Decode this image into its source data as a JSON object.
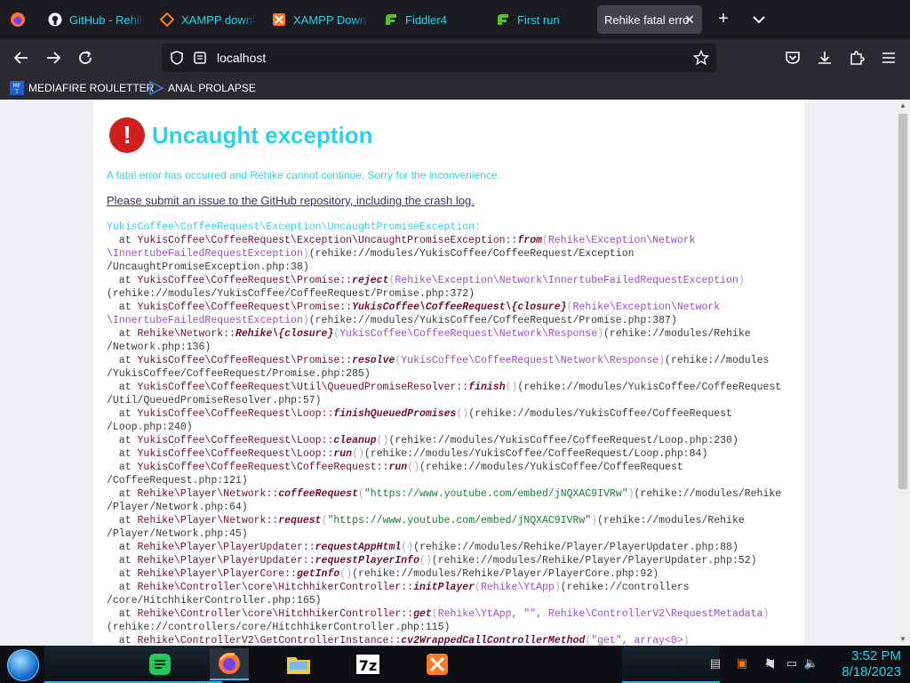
{
  "browser": {
    "tabs": [
      {
        "label": "GitHub - Rehike",
        "icon": "github-icon",
        "active": false
      },
      {
        "label": "XAMPP download",
        "icon": "xampp-icon",
        "active": false
      },
      {
        "label": "XAMPP Downloads",
        "icon": "xampp-icon",
        "active": false
      },
      {
        "label": "Fiddler4",
        "icon": "fiddler-icon",
        "active": false
      },
      {
        "label": "First run",
        "icon": "fiddler-icon",
        "active": false
      },
      {
        "label": "Rehike fatal error",
        "icon": "",
        "active": true
      }
    ],
    "url": "localhost",
    "bookmarks": [
      {
        "label": "MEDIAFIRE ROULETTER",
        "icon": "mf-icon"
      },
      {
        "label": "ANAL PROLAPSE",
        "icon": "bookmark-icon"
      }
    ]
  },
  "page": {
    "title": "Uncaught exception",
    "description": "A fatal error has occurred and Rehike cannot continue. Sorry for the inconvenience.",
    "submit_link": "Please submit an issue to the GitHub repository, including the crash log.",
    "exception": "YukisCoffee\\CoffeeRequest\\Exception\\UncaughtPromiseException:",
    "trace": [
      {
        "cls": "YukisCoffee\\CoffeeRequest\\Exception\\UncaughtPromiseException::",
        "meth": "from",
        "args": "Rehike\\Exception\\Network\n\\InnertubeFailedRequestException",
        "argtype": "arg",
        "loc": "(rehike://modules/YukisCoffee/CoffeeRequest/Exception\n/UncaughtPromiseException.php:38)"
      },
      {
        "cls": "YukisCoffee\\CoffeeRequest\\Promise::",
        "meth": "reject",
        "args": "Rehike\\Exception\\Network\\InnertubeFailedRequestException",
        "argtype": "arg",
        "loc": "\n(rehike://modules/YukisCoffee/CoffeeRequest/Promise.php:372)"
      },
      {
        "cls": "YukisCoffee\\CoffeeRequest\\Promise::",
        "meth": "YukisCoffee\\CoffeeRequest\\{closure}",
        "args": "Rehike\\Exception\\Network\n\\InnertubeFailedRequestException",
        "argtype": "arg",
        "loc": "(rehike://modules/YukisCoffee/CoffeeRequest/Promise.php:387)"
      },
      {
        "cls": "Rehike\\Network::",
        "meth": "Rehike\\{closure}",
        "args": "YukisCoffee\\CoffeeRequest\\Network\\Response",
        "argtype": "arg",
        "loc": "(rehike://modules/Rehike\n/Network.php:136)"
      },
      {
        "cls": "YukisCoffee\\CoffeeRequest\\Promise::",
        "meth": "resolve",
        "args": "YukisCoffee\\CoffeeRequest\\Network\\Response",
        "argtype": "arg",
        "loc": "(rehike://modules\n/YukisCoffee/CoffeeRequest/Promise.php:285)"
      },
      {
        "cls": "YukisCoffee\\CoffeeRequest\\Util\\QueuedPromiseResolver::",
        "meth": "finish",
        "args": "",
        "argtype": "arg",
        "loc": "(rehike://modules/YukisCoffee/CoffeeRequest\n/Util/QueuedPromiseResolver.php:57)"
      },
      {
        "cls": "YukisCoffee\\CoffeeRequest\\Loop::",
        "meth": "finishQueuedPromises",
        "args": "",
        "argtype": "arg",
        "loc": "(rehike://modules/YukisCoffee/CoffeeRequest\n/Loop.php:240)"
      },
      {
        "cls": "YukisCoffee\\CoffeeRequest\\Loop::",
        "meth": "cleanup",
        "args": "",
        "argtype": "arg",
        "loc": "(rehike://modules/YukisCoffee/CoffeeRequest/Loop.php:230)"
      },
      {
        "cls": "YukisCoffee\\CoffeeRequest\\Loop::",
        "meth": "run",
        "args": "",
        "argtype": "arg",
        "loc": "(rehike://modules/YukisCoffee/CoffeeRequest/Loop.php:84)"
      },
      {
        "cls": "YukisCoffee\\CoffeeRequest\\CoffeeRequest::",
        "meth": "run",
        "args": "",
        "argtype": "arg",
        "loc": "(rehike://modules/YukisCoffee/CoffeeRequest\n/CoffeeRequest.php:121)"
      },
      {
        "cls": "Rehike\\Player\\Network::",
        "meth": "coffeeRequest",
        "args": "\"https://www.youtube.com/embed/jNQXAC9IVRw\"",
        "argtype": "str",
        "loc": "(rehike://modules/Rehike\n/Player/Network.php:64)"
      },
      {
        "cls": "Rehike\\Player\\Network::",
        "meth": "request",
        "args": "\"https://www.youtube.com/embed/jNQXAC9IVRw\"",
        "argtype": "str",
        "loc": "(rehike://modules/Rehike\n/Player/Network.php:45)"
      },
      {
        "cls": "Rehike\\Player\\PlayerUpdater::",
        "meth": "requestAppHtml",
        "args": "",
        "argtype": "arg",
        "loc": "(rehike://modules/Rehike/Player/PlayerUpdater.php:88)"
      },
      {
        "cls": "Rehike\\Player\\PlayerUpdater::",
        "meth": "requestPlayerInfo",
        "args": "",
        "argtype": "arg",
        "loc": "(rehike://modules/Rehike/Player/PlayerUpdater.php:52)"
      },
      {
        "cls": "Rehike\\Player\\PlayerCore::",
        "meth": "getInfo",
        "args": "",
        "argtype": "arg",
        "loc": "(rehike://modules/Rehike/Player/PlayerCore.php:92)"
      },
      {
        "cls": "Rehike\\Controller\\core\\HitchhikerController::",
        "meth": "initPlayer",
        "args": "Rehike\\YtApp",
        "argtype": "arg",
        "loc": "(rehike://controllers\n/core/HitchhikerController.php:165)"
      },
      {
        "cls": "Rehike\\Controller\\core\\HitchhikerController::",
        "meth": "get",
        "args": "Rehike\\YtApp, \"\", Rehike\\ControllerV2\\RequestMetadata",
        "argtype": "arg",
        "loc": "\n(rehike://controllers/core/HitchhikerController.php:115)"
      },
      {
        "cls": "Rehike\\ControllerV2\\GetControllerInstance::",
        "meth": "cv2WrappedCallControllerMethod",
        "args": "\"get\", array<0>",
        "argtype": "arg",
        "loc": ""
      }
    ]
  },
  "taskbar": {
    "apps": [
      {
        "name": "messages-icon",
        "active": false
      },
      {
        "name": "firefox-icon",
        "active": true
      },
      {
        "name": "file-explorer-icon",
        "active": false
      },
      {
        "name": "7zip-icon",
        "label": "7z",
        "active": false
      },
      {
        "name": "xampp-icon",
        "active": false
      }
    ],
    "time": "3:52 PM",
    "date": "8/18/2023"
  },
  "colors": {
    "accent": "#2bd3e8",
    "error": "#d01f1f"
  }
}
